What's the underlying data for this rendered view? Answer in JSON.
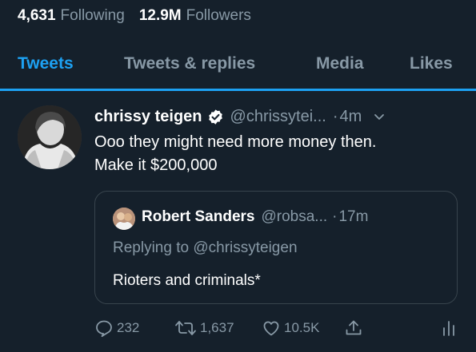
{
  "stats": {
    "following_count": "4,631",
    "following_label": "Following",
    "followers_count": "12.9M",
    "followers_label": "Followers"
  },
  "tabs": [
    {
      "label": "Tweets",
      "active": true
    },
    {
      "label": "Tweets & replies",
      "active": false
    },
    {
      "label": "Media",
      "active": false
    },
    {
      "label": "Likes",
      "active": false
    }
  ],
  "tweet": {
    "name": "chrissy teigen",
    "handle": "@chrissytei...",
    "separator": "·",
    "time": "4m",
    "text_lines": [
      "Ooo they might need more money then.",
      "Make it $200,000"
    ]
  },
  "quoted": {
    "name": "Robert Sanders",
    "handle": "@robsa...",
    "separator": "·",
    "time": "17m",
    "reply_line": "Replying to @chrissyteigen",
    "text": "Rioters and criminals*"
  },
  "actions": {
    "reply_count": "232",
    "retweet_count": "1,637",
    "like_count": "10.5K"
  },
  "colors": {
    "background": "#15202b",
    "accent": "#1da1f2",
    "muted": "#8899a6",
    "border": "#38444d"
  },
  "icons": [
    "verified-badge-icon",
    "chevron-down-icon",
    "reply-icon",
    "retweet-icon",
    "like-icon",
    "share-icon",
    "analytics-icon"
  ]
}
